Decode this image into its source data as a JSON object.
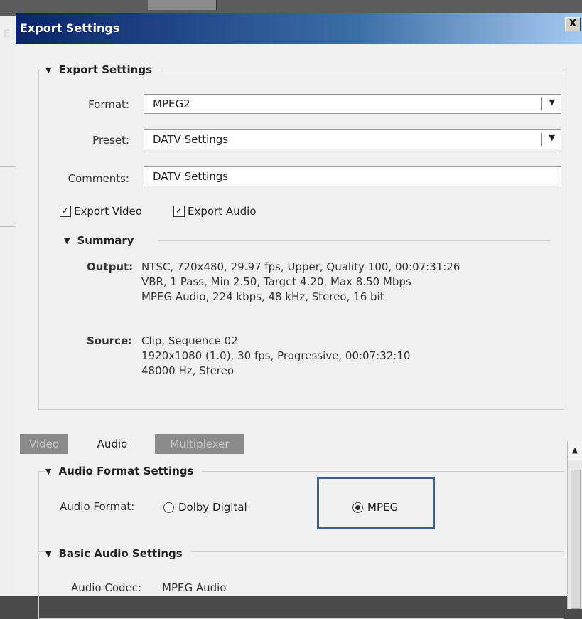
{
  "background": {
    "partial_letter": "E"
  },
  "window": {
    "title": "Export Settings",
    "close_label": "X"
  },
  "export_settings": {
    "heading": "Export Settings",
    "format": {
      "label": "Format:",
      "value": "MPEG2"
    },
    "preset": {
      "label": "Preset:",
      "value": "DATV Settings"
    },
    "comments": {
      "label": "Comments:",
      "value": "DATV Settings"
    },
    "export_video": {
      "label": "Export Video",
      "checked": true
    },
    "export_audio": {
      "label": "Export Audio",
      "checked": true
    }
  },
  "summary": {
    "heading": "Summary",
    "output_label": "Output:",
    "output_lines": [
      "NTSC, 720x480, 29.97 fps, Upper, Quality 100, 00:07:31:26",
      "VBR, 1 Pass, Min 2.50, Target 4.20, Max 8.50 Mbps",
      "MPEG Audio, 224 kbps, 48 kHz, Stereo, 16 bit"
    ],
    "source_label": "Source:",
    "source_lines": [
      "Clip, Sequence 02",
      "1920x1080 (1.0), 30 fps, Progressive, 00:07:32:10",
      "48000 Hz, Stereo"
    ]
  },
  "tabs": [
    {
      "label": "Video",
      "active": false
    },
    {
      "label": "Audio",
      "active": true
    },
    {
      "label": "Multiplexer",
      "active": false
    }
  ],
  "audio_format_settings": {
    "heading": "Audio Format Settings",
    "label": "Audio Format:",
    "options": [
      {
        "label": "Dolby Digital",
        "selected": false
      },
      {
        "label": "MPEG",
        "selected": true
      }
    ]
  },
  "basic_audio_settings": {
    "heading": "Basic Audio Settings",
    "codec_label": "Audio Codec:",
    "codec_value": "MPEG Audio"
  },
  "colors": {
    "highlight_border": "#3d5f8a",
    "title_gradient_start": "#0a246a"
  }
}
